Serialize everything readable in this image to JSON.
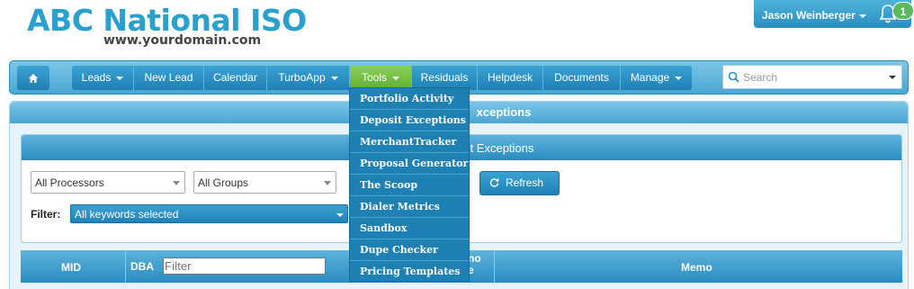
{
  "brand": {
    "title": "ABC National ISO",
    "subtitle": "www.yourdomain.com"
  },
  "user": {
    "name": "Jason Weinberger",
    "notification_count": "1"
  },
  "nav": {
    "items": [
      {
        "label": "Leads",
        "has_caret": true
      },
      {
        "label": "New Lead",
        "has_caret": false
      },
      {
        "label": "Calendar",
        "has_caret": false
      },
      {
        "label": "TurboApp",
        "has_caret": true
      },
      {
        "label": "Tools",
        "has_caret": true,
        "active": true
      },
      {
        "label": "Residuals",
        "has_caret": false
      },
      {
        "label": "Helpdesk",
        "has_caret": false
      },
      {
        "label": "Documents",
        "has_caret": false
      },
      {
        "label": "Manage",
        "has_caret": true
      }
    ],
    "search_placeholder": "Search",
    "active_color": "#6cbf3a",
    "accent_color": "#2a8cc0"
  },
  "tools_menu": {
    "items": [
      "Portfolio Activity",
      "Deposit Exceptions",
      "MerchantTracker",
      "Proposal Generator",
      "The Scoop",
      "Dialer Metrics",
      "Sandbox",
      "Dupe Checker",
      "Pricing Templates"
    ]
  },
  "page": {
    "outer_title_visible": "xceptions",
    "inner_title_visible": "t Exceptions"
  },
  "filters": {
    "processor": "All Processors",
    "group": "All Groups",
    "refresh_label": "Refresh",
    "filter_label": "Filter:",
    "keywords": "All keywords selected"
  },
  "table": {
    "col_mid": "MID",
    "col_dba": "DBA",
    "dba_placeholder": "Filter",
    "col_partial_line1": "no",
    "col_partial_line2": "e",
    "col_memo": "Memo"
  }
}
